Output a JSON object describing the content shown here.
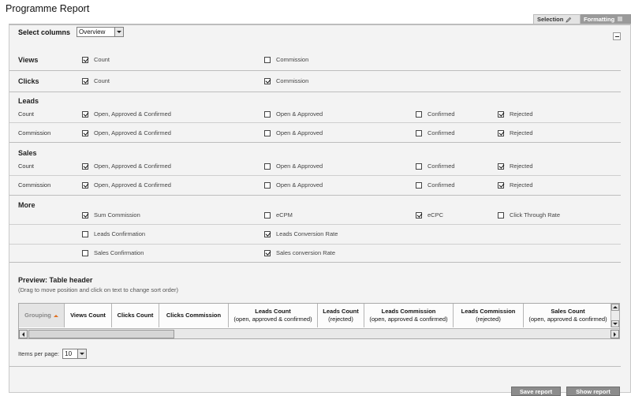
{
  "page": {
    "title": "Programme Report"
  },
  "tabs": {
    "selection": "Selection",
    "formatting": "Formatting"
  },
  "select_columns": {
    "label": "Select columns",
    "value": "Overview"
  },
  "views": {
    "title": "Views",
    "count": {
      "label": "Count",
      "checked": true
    },
    "commission": {
      "label": "Commission",
      "checked": false
    }
  },
  "clicks": {
    "title": "Clicks",
    "count": {
      "label": "Count",
      "checked": true
    },
    "commission": {
      "label": "Commission",
      "checked": true
    }
  },
  "leads": {
    "title": "Leads",
    "rows": [
      {
        "label": "Count",
        "options": [
          {
            "label": "Open, Approved & Confirmed",
            "checked": true
          },
          {
            "label": "Open & Approved",
            "checked": false
          },
          {
            "label": "Confirmed",
            "checked": false
          },
          {
            "label": "Rejected",
            "checked": true
          }
        ]
      },
      {
        "label": "Commission",
        "options": [
          {
            "label": "Open, Approved & Confirmed",
            "checked": true
          },
          {
            "label": "Open & Approved",
            "checked": false
          },
          {
            "label": "Confirmed",
            "checked": false
          },
          {
            "label": "Rejected",
            "checked": true
          }
        ]
      }
    ]
  },
  "sales": {
    "title": "Sales",
    "rows": [
      {
        "label": "Count",
        "options": [
          {
            "label": "Open, Approved & Confirmed",
            "checked": true
          },
          {
            "label": "Open & Approved",
            "checked": false
          },
          {
            "label": "Confirmed",
            "checked": false
          },
          {
            "label": "Rejected",
            "checked": true
          }
        ]
      },
      {
        "label": "Commission",
        "options": [
          {
            "label": "Open, Approved & Confirmed",
            "checked": true
          },
          {
            "label": "Open & Approved",
            "checked": false
          },
          {
            "label": "Confirmed",
            "checked": false
          },
          {
            "label": "Rejected",
            "checked": true
          }
        ]
      }
    ]
  },
  "more": {
    "title": "More",
    "rows": [
      [
        {
          "label": "Sum Commission",
          "checked": true
        },
        {
          "label": "eCPM",
          "checked": false
        },
        {
          "label": "eCPC",
          "checked": true
        },
        {
          "label": "Click Through Rate",
          "checked": false
        }
      ],
      [
        {
          "label": "Leads Confirmation",
          "checked": false
        },
        {
          "label": "Leads Conversion Rate",
          "checked": true
        }
      ],
      [
        {
          "label": "Sales Confirmation",
          "checked": false
        },
        {
          "label": "Sales conversion Rate",
          "checked": true
        }
      ]
    ]
  },
  "preview": {
    "title": "Preview: Table header",
    "hint": "(Drag to move position and click on text to change sort order)",
    "columns": [
      {
        "title": "Grouping",
        "sub": ""
      },
      {
        "title": "Views Count",
        "sub": ""
      },
      {
        "title": "Clicks Count",
        "sub": ""
      },
      {
        "title": "Clicks Commission",
        "sub": ""
      },
      {
        "title": "Leads Count",
        "sub": "(open, approved & confirmed)"
      },
      {
        "title": "Leads Count",
        "sub": "(rejected)"
      },
      {
        "title": "Leads Commission",
        "sub": "(open, approved & confirmed)"
      },
      {
        "title": "Leads Commission",
        "sub": "(rejected)"
      },
      {
        "title": "Sales Count",
        "sub": "(open, approved & confirmed)"
      }
    ]
  },
  "items_per_page": {
    "label": "Items per page:",
    "value": "10"
  },
  "buttons": {
    "save": "Save report",
    "show": "Show report"
  },
  "colors": {
    "panel_bg": "#f3f3f3",
    "button_bg": "#8c8c8c",
    "sort_arrow": "#e07020"
  }
}
